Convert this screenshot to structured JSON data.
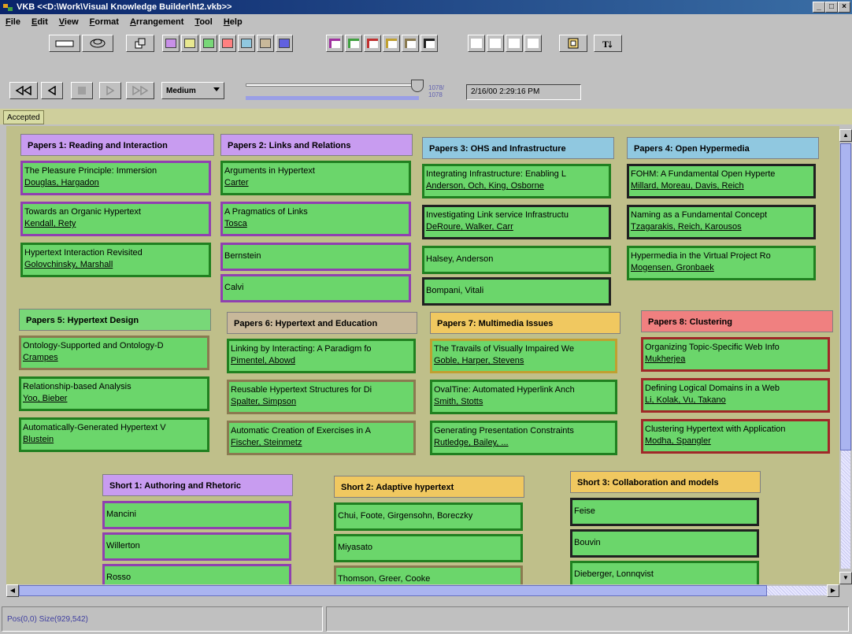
{
  "window": {
    "title": "VKB  <<D:\\Work\\Visual Knowledge Builder\\ht2.vkb>>",
    "app_icon": "vkb-app-icon",
    "minimize": "_",
    "maximize": "□",
    "close": "×"
  },
  "menu": [
    {
      "mnemonic": "F",
      "rest": "ile"
    },
    {
      "mnemonic": "E",
      "rest": "dit"
    },
    {
      "mnemonic": "V",
      "rest": "iew"
    },
    {
      "mnemonic": "F",
      "rest": "ormat"
    },
    {
      "mnemonic": "A",
      "rest": "rrangement"
    },
    {
      "mnemonic": "T",
      "rest": "ool"
    },
    {
      "mnemonic": "H",
      "rest": "elp"
    }
  ],
  "toolbar": {
    "fill_colors": [
      "#c890e8",
      "#e8e890",
      "#78d878",
      "#ff8080",
      "#90c8e0",
      "#c8b89a",
      "#6060e0"
    ],
    "border_colors": [
      "#a030a0",
      "#40a040",
      "#c03030",
      "#c0a030",
      "#8a7a50",
      "#202020"
    ],
    "icons": [
      "new-collection-icon",
      "link-icon",
      "stack-icon",
      "image-icon",
      "text-size-icon"
    ]
  },
  "playback": {
    "speed": "Medium",
    "counter_top": "1078/",
    "counter_bottom": "1078",
    "timestamp": "2/16/00 2:29:16 PM",
    "progress": 1.0
  },
  "tab": {
    "label": "Accepted"
  },
  "collections": [
    {
      "title": "Papers 1: Reading and Interaction",
      "color": "#c89cf0",
      "items": [
        {
          "line1": "The Pleasure Principle: Immersion",
          "line2": "Douglas, Hargadon",
          "border": "#9040b0"
        },
        {
          "line1": "Towards an Organic Hypertext",
          "line2": "Kendall, Rety",
          "border": "#9040b0"
        },
        {
          "line1": "Hypertext Interaction Revisited",
          "line2": "Golovchinsky, Marshall",
          "border": "#208020"
        }
      ]
    },
    {
      "title": "Papers 2: Links and Relations",
      "color": "#c89cf0",
      "items": [
        {
          "line1": "Arguments in Hypertext",
          "line2": "Carter",
          "border": "#208020"
        },
        {
          "line1": "A Pragmatics of Links",
          "line2": "Tosca",
          "border": "#9040b0"
        },
        {
          "line1": "Bernstein",
          "line2": "",
          "border": "#9040b0"
        },
        {
          "line1": "Calvi",
          "line2": "",
          "border": "#9040b0"
        }
      ]
    },
    {
      "title": "Papers 3: OHS and Infrastructure",
      "color": "#90c8e0",
      "items": [
        {
          "line1": "Integrating Infrastructure: Enabling L",
          "line2": "Anderson, Och, King, Osborne",
          "border": "#208020"
        },
        {
          "line1": "Investigating Link service Infrastructu",
          "line2": "DeRoure, Walker, Carr",
          "border": "#202020"
        },
        {
          "line1": "Halsey, Anderson",
          "line2": "",
          "border": "#208020"
        },
        {
          "line1": "Bompani, Vitali",
          "line2": "",
          "border": "#202020"
        }
      ]
    },
    {
      "title": "Papers 4: Open Hypermedia",
      "color": "#90c8e0",
      "items": [
        {
          "line1": "FOHM: A Fundamental Open Hyperte",
          "line2": "Millard, Moreau, Davis, Reich",
          "border": "#202020"
        },
        {
          "line1": "Naming as a Fundamental Concept",
          "line2": "Tzagarakis, Reich, Karousos",
          "border": "#202020"
        },
        {
          "line1": "Hypermedia in the Virtual Project Ro",
          "line2": "Mogensen, Gronbaek",
          "border": "#208020"
        }
      ]
    },
    {
      "title": "Papers 5: Hypertext Design",
      "color": "#78d878",
      "items": [
        {
          "line1": "Ontology-Supported and Ontology-D",
          "line2": "Crampes",
          "border": "#8a7a50"
        },
        {
          "line1": "Relationship-based Analysis",
          "line2": "Yoo, Bieber",
          "border": "#208020"
        },
        {
          "line1": "Automatically-Generated Hypertext V",
          "line2": "Blustein",
          "border": "#208020"
        }
      ]
    },
    {
      "title": "Papers 6: Hypertext and Education",
      "color": "#c8b89a",
      "items": [
        {
          "line1": "Linking by Interacting: A Paradigm fo",
          "line2": "Pimentel, Abowd",
          "border": "#208020"
        },
        {
          "line1": "Reusable Hypertext Structures for Di",
          "line2": "Spalter, Simpson",
          "border": "#8a7a50"
        },
        {
          "line1": "Automatic Creation of Exercises in A",
          "line2": "Fischer, Steinmetz",
          "border": "#8a7a50"
        }
      ]
    },
    {
      "title": "Papers 7: Multimedia Issues",
      "color": "#f0c860",
      "items": [
        {
          "line1": "The Travails of Visually Impaired We",
          "line2": "Goble, Harper, Stevens",
          "border": "#c0a030"
        },
        {
          "line1": "OvalTine: Automated Hyperlink Anch",
          "line2": "Smith, Stotts",
          "border": "#208020"
        },
        {
          "line1": "Generating Presentation Constraints",
          "line2": "Rutledge, Bailey, ...",
          "border": "#208020"
        }
      ]
    },
    {
      "title": "Papers 8: Clustering",
      "color": "#f08080",
      "items": [
        {
          "line1": "Organizing Topic-Specific Web Info",
          "line2": "Mukherjea",
          "border": "#a02828"
        },
        {
          "line1": "Defining Logical Domains in a Web",
          "line2": "Li, Kolak, Vu, Takano",
          "border": "#a02828"
        },
        {
          "line1": "Clustering Hypertext with Application",
          "line2": "Modha, Spangler",
          "border": "#a02828"
        }
      ]
    },
    {
      "title": "Short 1: Authoring and Rhetoric",
      "color": "#c89cf0",
      "items": [
        {
          "line1": "Mancini",
          "line2": "",
          "border": "#9040b0"
        },
        {
          "line1": "Willerton",
          "line2": "",
          "border": "#9040b0"
        },
        {
          "line1": "Rosso",
          "line2": "",
          "border": "#9040b0"
        }
      ]
    },
    {
      "title": "Short 2: Adaptive hypertext",
      "color": "#f0c860",
      "items": [
        {
          "line1": "Chui, Foote, Girgensohn, Boreczky",
          "line2": "",
          "border": "#208020"
        },
        {
          "line1": "Miyasato",
          "line2": "",
          "border": "#208020"
        },
        {
          "line1": "Thomson, Greer, Cooke",
          "line2": "",
          "border": "#8a7a50"
        }
      ]
    },
    {
      "title": "Short 3: Collaboration and models",
      "color": "#f0c860",
      "items": [
        {
          "line1": "Feise",
          "line2": "",
          "border": "#202020"
        },
        {
          "line1": "Bouvin",
          "line2": "",
          "border": "#202020"
        },
        {
          "line1": "Dieberger, Lonnqvist",
          "line2": "",
          "border": "#208020"
        }
      ]
    }
  ],
  "status": {
    "text": "Pos(0,0) Size(929,542)"
  }
}
